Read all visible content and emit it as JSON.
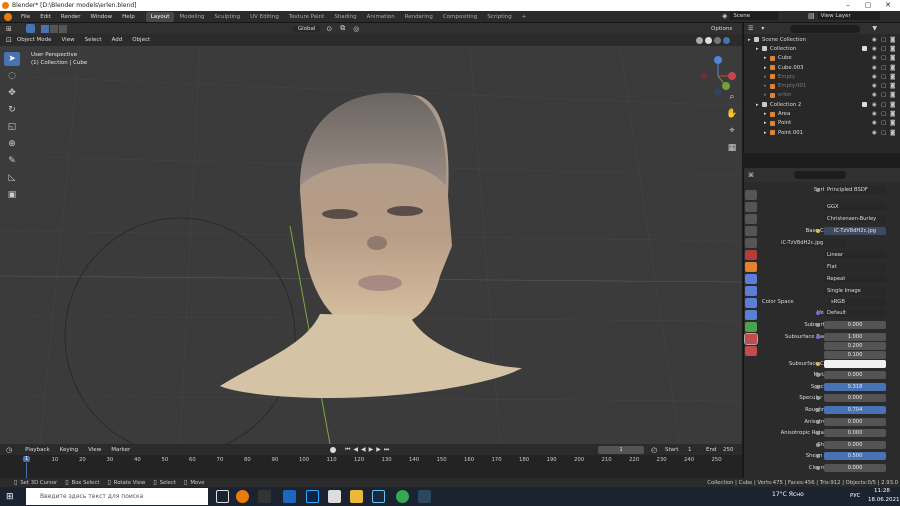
{
  "window": {
    "title": "Blender* [D:\\Blender models\\erlen.blend]",
    "min": "–",
    "max": "▢",
    "close": "✕"
  },
  "menu": [
    "File",
    "Edit",
    "Render",
    "Window",
    "Help"
  ],
  "workspaces": [
    "Layout",
    "Modeling",
    "Sculpting",
    "UV Editing",
    "Texture Paint",
    "Shading",
    "Animation",
    "Rendering",
    "Compositing",
    "Scripting",
    "+"
  ],
  "scene_label": "Scene",
  "view_layer_label": "View Layer",
  "viewport": {
    "mode": "Object Mode",
    "menus": [
      "View",
      "Select",
      "Add",
      "Object"
    ],
    "orientation": "Global",
    "options_label": "Options",
    "info_line1": "User Perspective",
    "info_line2": "(1) Collection | Cube"
  },
  "outliner": {
    "search_placeholder": "",
    "rows": [
      {
        "label": "Scene Collection",
        "indent": 0,
        "dim": false,
        "checkbox": false
      },
      {
        "label": "Collection",
        "indent": 1,
        "dim": false,
        "checkbox": true
      },
      {
        "label": "Cube",
        "indent": 2,
        "dim": false,
        "checkbox": false
      },
      {
        "label": "Cube.003",
        "indent": 2,
        "dim": false,
        "checkbox": false
      },
      {
        "label": "Empty",
        "indent": 2,
        "dim": true,
        "checkbox": false
      },
      {
        "label": "Empty.001",
        "indent": 2,
        "dim": true,
        "checkbox": false
      },
      {
        "label": "erlen",
        "indent": 2,
        "dim": true,
        "checkbox": false
      },
      {
        "label": "Collection 2",
        "indent": 1,
        "dim": false,
        "checkbox": true
      },
      {
        "label": "Area",
        "indent": 2,
        "dim": false,
        "checkbox": false
      },
      {
        "label": "Point",
        "indent": 2,
        "dim": false,
        "checkbox": false
      },
      {
        "label": "Point.001",
        "indent": 2,
        "dim": false,
        "checkbox": false
      }
    ]
  },
  "properties": {
    "surface_label": "Surface",
    "surface_value": "Principled BSDF",
    "distribution": "GGX",
    "subsurface_method": "Christensen-Burley",
    "base_color_label": "Base Color",
    "base_color_value": "iC-TzV8dH2c.jpg",
    "image_name": "iC-TzV8dH2c.jpg",
    "image_users": "2",
    "interpolation": "Linear",
    "projection": "Flat",
    "extension": "Repeat",
    "source": "Single Image",
    "color_space_label": "Color Space",
    "color_space_value": "sRGB",
    "vector_label": "Vector",
    "vector_value": "Default",
    "rows": [
      {
        "label": "Subsurface",
        "value": "0.000",
        "blue": false,
        "dot": "g"
      },
      {
        "label": "Subsurface Radius",
        "value": "1.000",
        "blue": false,
        "dot": "p"
      },
      {
        "label": "",
        "value": "0.200",
        "blue": false,
        "dot": ""
      },
      {
        "label": "",
        "value": "0.100",
        "blue": false,
        "dot": ""
      },
      {
        "label": "Subsurface Color",
        "value": "",
        "blue": false,
        "dot": "y",
        "white": true
      },
      {
        "label": "Metallic",
        "value": "0.000",
        "blue": false,
        "dot": "g"
      },
      {
        "label": "Specular",
        "value": "0.318",
        "blue": true,
        "dot": "g"
      },
      {
        "label": "Specular Tint",
        "value": "0.000",
        "blue": false,
        "dot": "g"
      },
      {
        "label": "Roughness",
        "value": "0.704",
        "blue": true,
        "dot": "g"
      },
      {
        "label": "Anisotropic",
        "value": "0.000",
        "blue": false,
        "dot": "g"
      },
      {
        "label": "Anisotropic Rotation",
        "value": "0.000",
        "blue": false,
        "dot": "g"
      },
      {
        "label": "Sheen",
        "value": "0.000",
        "blue": false,
        "dot": "g"
      },
      {
        "label": "Sheen Tint",
        "value": "0.500",
        "blue": true,
        "dot": "g"
      },
      {
        "label": "Clearcoat",
        "value": "0.000",
        "blue": false,
        "dot": "g"
      }
    ]
  },
  "timeline": {
    "menus": [
      "Playback",
      "Keying",
      "View",
      "Marker"
    ],
    "current_frame": "1",
    "start_label": "Start",
    "start": "1",
    "end_label": "End",
    "end": "250",
    "ticks": [
      "0",
      "10",
      "20",
      "30",
      "40",
      "50",
      "60",
      "70",
      "80",
      "90",
      "100",
      "110",
      "120",
      "130",
      "140",
      "150",
      "160",
      "170",
      "180",
      "190",
      "200",
      "210",
      "220",
      "230",
      "240",
      "250"
    ],
    "playhead": "1"
  },
  "status": {
    "left": [
      "Set 3D Cursor",
      "Box Select",
      "Rotate View",
      "Select",
      "Move"
    ],
    "right": "Collection | Cube | Verts:475 | Faces:456 | Tris:912 | Objects:0/5 | 2.93.0"
  },
  "taskbar": {
    "search": "Введите здесь текст для поиска",
    "weather": "17°C Ясно",
    "lang": "РУС",
    "time": "11:28",
    "date": "18.06.2021"
  }
}
